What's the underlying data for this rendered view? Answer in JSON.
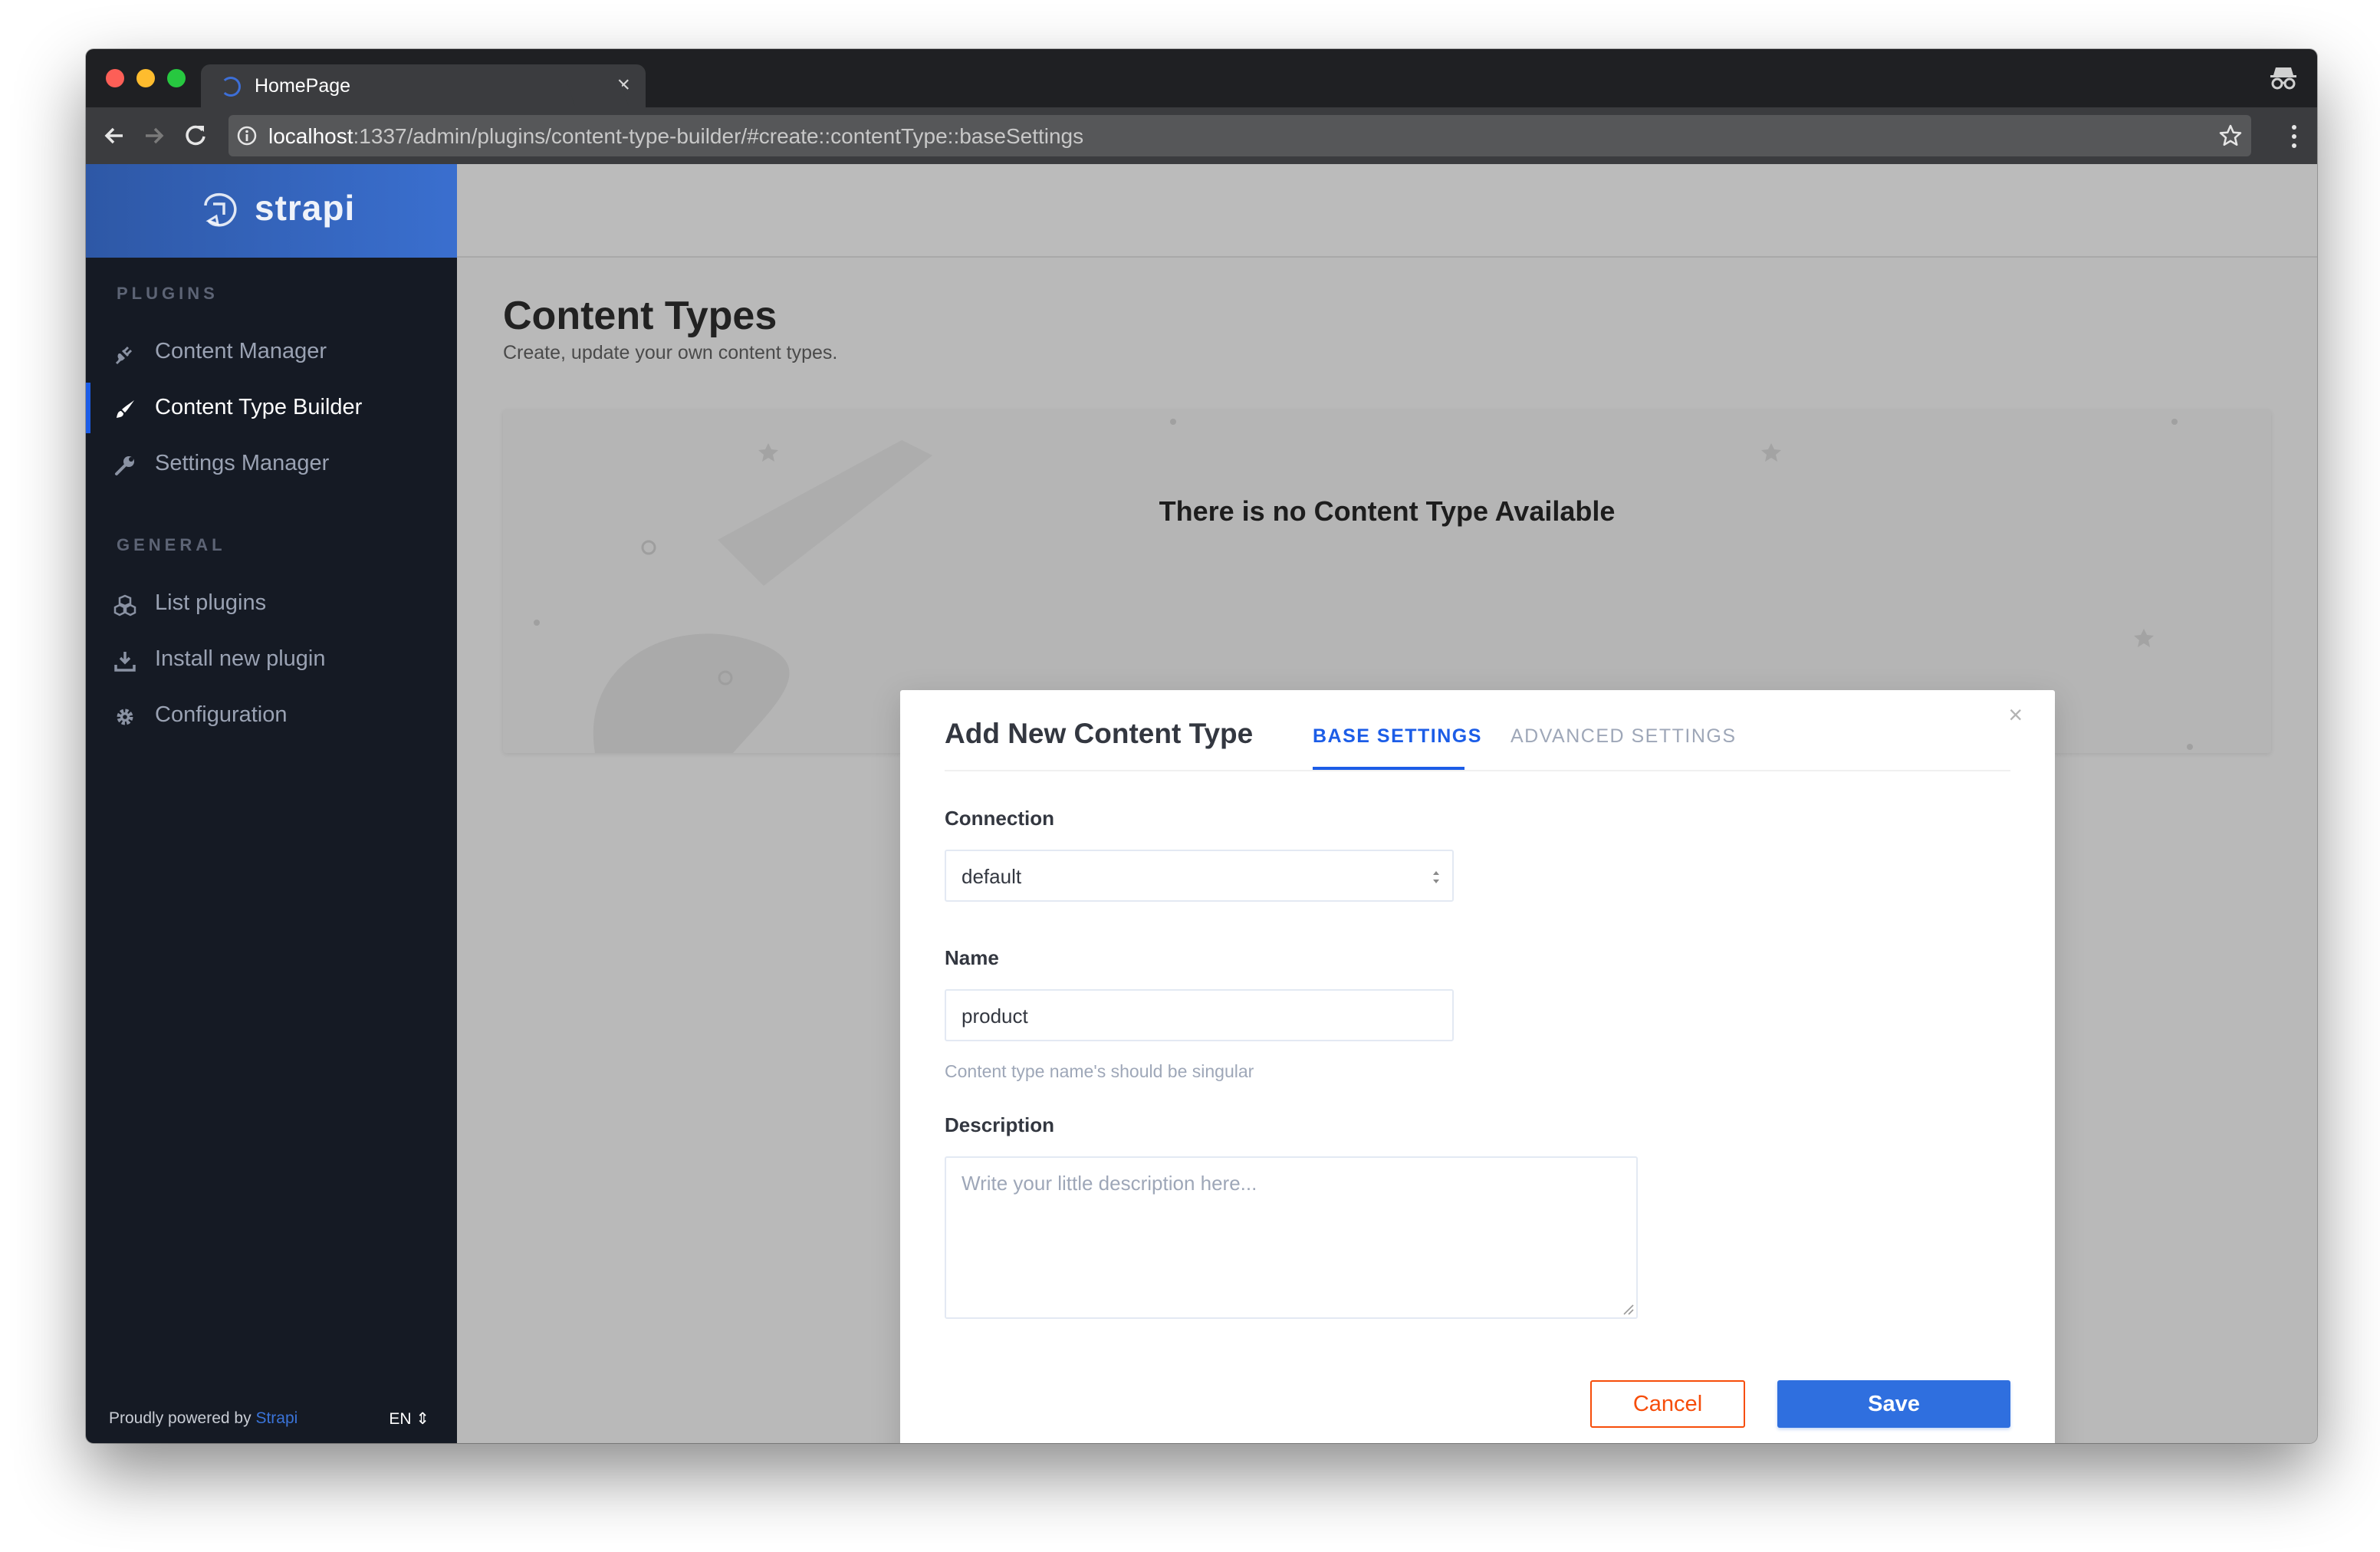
{
  "browser": {
    "tab_title": "HomePage",
    "tab_close": "×",
    "url_host": "localhost",
    "url_rest": ":1337/admin/plugins/content-type-builder/#create::contentType::baseSettings"
  },
  "sidebar": {
    "brand": "strapi",
    "plugins_title": "PLUGINS",
    "plugins": [
      {
        "label": "Content Manager",
        "icon": "plug-icon"
      },
      {
        "label": "Content Type Builder",
        "icon": "paint-brush-icon",
        "active": true
      },
      {
        "label": "Settings Manager",
        "icon": "wrench-icon"
      }
    ],
    "general_title": "GENERAL",
    "general": [
      {
        "label": "List plugins",
        "icon": "cubes-icon"
      },
      {
        "label": "Install new plugin",
        "icon": "download-icon"
      },
      {
        "label": "Configuration",
        "icon": "gear-icon"
      }
    ],
    "footer_text": "Proudly powered by ",
    "footer_link": "Strapi",
    "language": "EN"
  },
  "main": {
    "title": "Content Types",
    "subtitle": "Create, update your own content types.",
    "empty_title": "There is no Content Type Available"
  },
  "modal": {
    "title": "Add New Content Type",
    "close": "×",
    "tabs": [
      {
        "label": "BASE SETTINGS",
        "active": true
      },
      {
        "label": "ADVANCED SETTINGS",
        "active": false
      }
    ],
    "connection_label": "Connection",
    "connection_value": "default",
    "name_label": "Name",
    "name_value": "product",
    "name_hint": "Content type name's should be singular",
    "description_label": "Description",
    "description_placeholder": "Write your little description here...",
    "cancel": "Cancel",
    "save": "Save"
  },
  "colors": {
    "accent": "#1c5de7",
    "save_button": "#2f6fdf",
    "cancel_border": "#f64d0a",
    "sidebar_bg": "#151a24"
  }
}
